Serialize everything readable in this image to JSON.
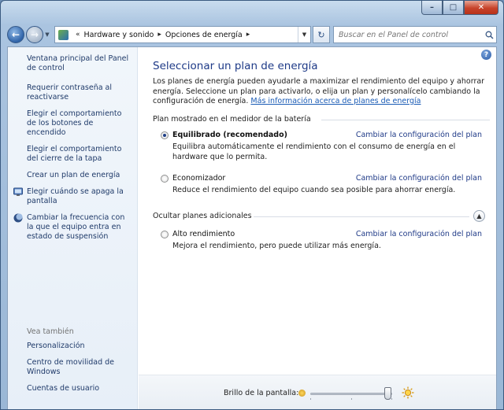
{
  "window": {
    "caption": {
      "minimize": "–",
      "maximize": "□",
      "close": "✕"
    }
  },
  "address": {
    "separator": "«",
    "crumbs": [
      "Hardware y sonido",
      "Opciones de energía"
    ]
  },
  "search": {
    "placeholder": "Buscar en el Panel de control"
  },
  "sidebar": {
    "items": [
      {
        "label": "Ventana principal del Panel de control",
        "icon": null
      },
      {
        "label": "Requerir contraseña al reactivarse",
        "icon": null
      },
      {
        "label": "Elegir el comportamiento de los botones de encendido",
        "icon": null
      },
      {
        "label": "Elegir el comportamiento del cierre de la tapa",
        "icon": null
      },
      {
        "label": "Crear un plan de energía",
        "icon": null
      },
      {
        "label": "Elegir cuándo se apaga la pantalla",
        "icon": "monitor-icon"
      },
      {
        "label": "Cambiar la frecuencia con la que el equipo entra en estado de suspensión",
        "icon": "moon-icon"
      }
    ],
    "see_also": {
      "title": "Vea también",
      "items": [
        "Personalización",
        "Centro de movilidad de Windows",
        "Cuentas de usuario"
      ]
    }
  },
  "main": {
    "title": "Seleccionar un plan de energía",
    "intro": "Los planes de energía pueden ayudarle a maximizar el rendimiento del equipo y ahorrar energía. Seleccione un plan para activarlo, o elija un plan y personalícelo cambiando la configuración de energía.",
    "intro_link": "Más información acerca de planes de energía",
    "battery_section": "Plan mostrado en el medidor de la batería",
    "plans": [
      {
        "name": "Equilibrado (recomendado)",
        "selected": true,
        "change": "Cambiar la configuración del plan",
        "desc": "Equilibra automáticamente el rendimiento con el consumo de energía en el hardware que lo permita."
      },
      {
        "name": "Economizador",
        "selected": false,
        "change": "Cambiar la configuración del plan",
        "desc": "Reduce el rendimiento del equipo cuando sea posible para ahorrar energía."
      }
    ],
    "hidden_section": "Ocultar planes adicionales",
    "extra_plans": [
      {
        "name": "Alto rendimiento",
        "selected": false,
        "change": "Cambiar la configuración del plan",
        "desc": "Mejora el rendimiento, pero puede utilizar más energía."
      }
    ],
    "brightness": {
      "label": "Brillo de la pantalla:",
      "value_fraction": 0.95
    }
  }
}
